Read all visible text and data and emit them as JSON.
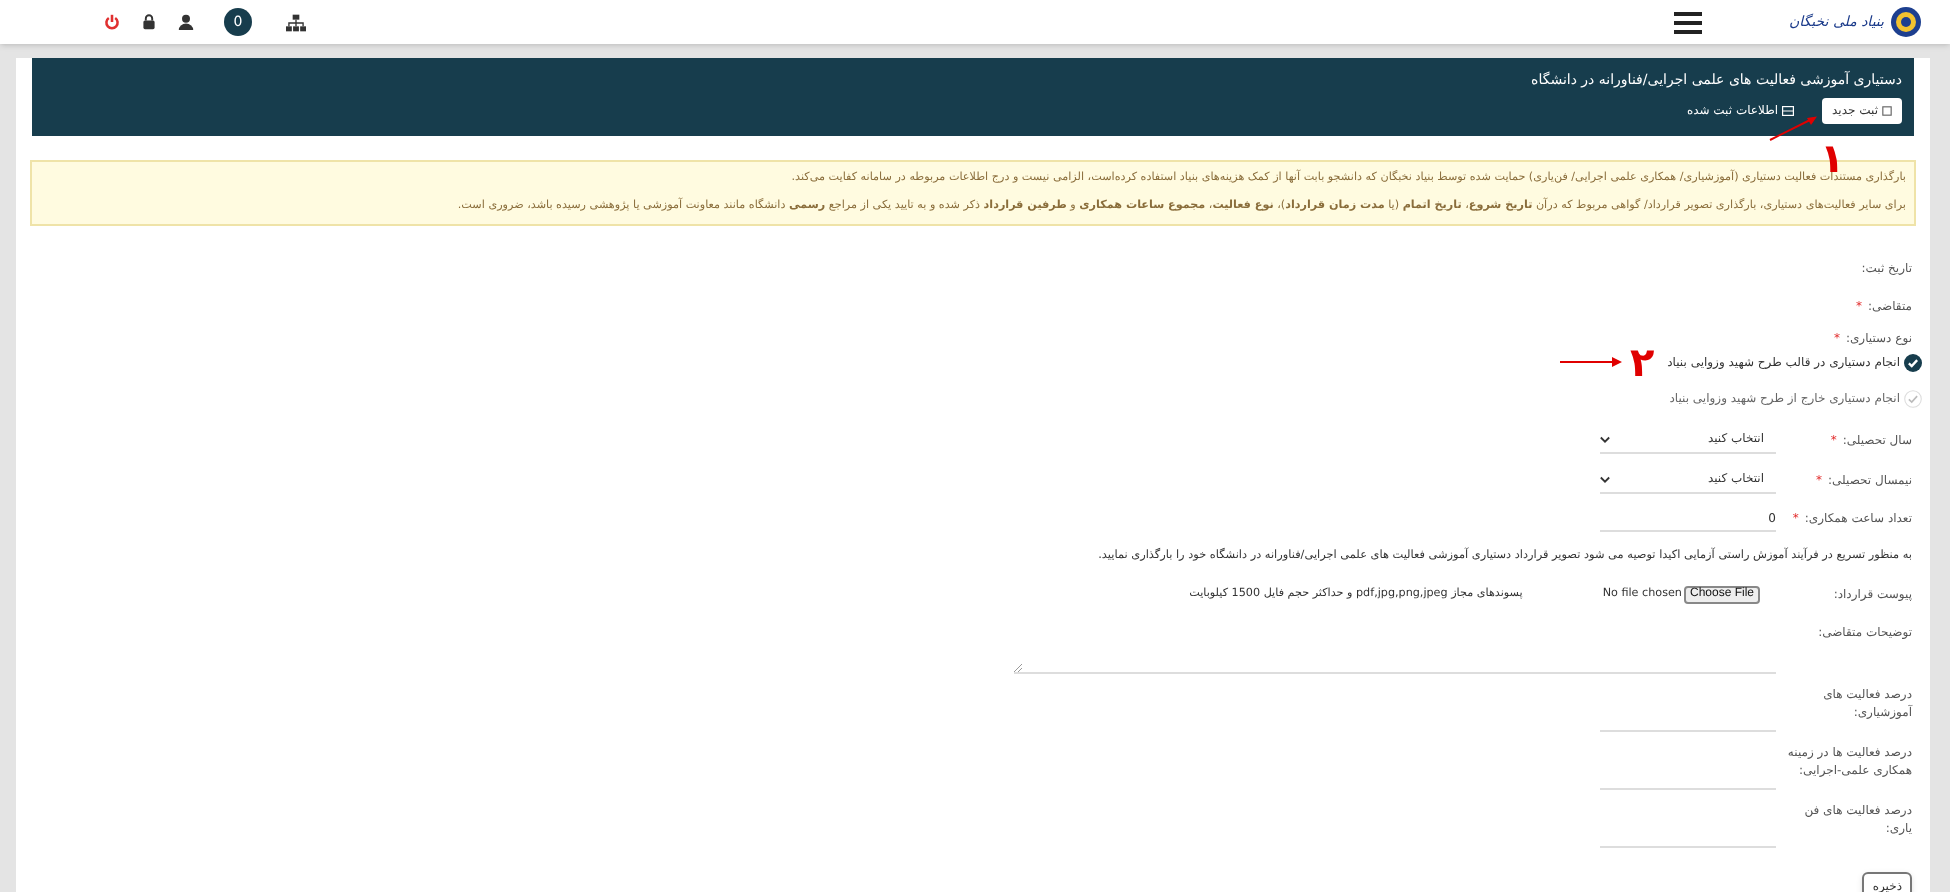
{
  "header": {
    "logo_text": "بنیاد ملی نخبگان",
    "badge": "0"
  },
  "panel": {
    "title": "دستیاری آموزشی فعالیت های علمی اجرایی/فناورانه در دانشگاه",
    "buttons": [
      {
        "label": "ثبت جدید",
        "kind": "new"
      },
      {
        "label": "اطلاعات ثبت شده",
        "kind": "list"
      }
    ]
  },
  "notice": {
    "lines": [
      "بارگذاری مستندات فعالیت دستیاری (آموزشیاری/ همکاری علمی اجرایی/ فن‌یاری) حمایت شده توسط بنیاد نخبگان که دانشجو بابت آنها از کمک هزینه‌های بنیاد استفاده کرده‌است، الزامی نیست و درج اطلاعات مربوطه در سامانه کفایت می‌کند.",
      "برای سایر فعالیت‌های دستیاری، بارگذاری تصویر قرارداد/ گواهی مربوط که درآن **تاریخ شروع**، **تاریخ اتمام** (یا **مدت زمان قرارداد**)، **نوع فعالیت**، **مجموع ساعات همکاری** و **طرفین قرارداد** ذکر شده و به تایید یکی از مراجع **رسمی** دانشگاه مانند معاونت آموزشی یا پژوهشی رسیده باشد، ضروری است."
    ]
  },
  "form": {
    "required_mark": "*",
    "fields": [
      {
        "kind": "static",
        "label": "تاریخ ثبت:",
        "required": false
      },
      {
        "kind": "static",
        "label": "متقاضی:",
        "required": true
      },
      {
        "kind": "radio",
        "label": "نوع دستیاری:",
        "required": true,
        "options": [
          {
            "label": "انجام دستیاری در قالب طرح شهید وزوایی بنیاد",
            "selected": true
          },
          {
            "label": "انجام دستیاری خارج از طرح شهید وزوایی بنیاد",
            "selected": false
          }
        ]
      },
      {
        "kind": "select",
        "label": "سال تحصیلی:",
        "required": true,
        "value": "انتخاب کنید"
      },
      {
        "kind": "select",
        "label": "نیمسال تحصیلی:",
        "required": true,
        "value": "انتخاب کنید"
      },
      {
        "kind": "text",
        "label": "تعداد ساعت همکاری:",
        "required": true,
        "value": "0"
      },
      {
        "kind": "note",
        "text": "به منظور تسریع در فرآیند آموزش راستی آزمایی اکیدا توصیه می شود تصویر قرارداد دستیاری آموزشی فعالیت های علمی اجرایی/فناورانه در دانشگاه خود را بارگذاری نمایید."
      },
      {
        "kind": "file",
        "label": "پیوست قرارداد:",
        "required": false,
        "button": "Choose File",
        "status": "No file chosen",
        "hint": "پسوندهای مجاز pdf,jpg,png,jpeg و حداکثر حجم فایل 1500 کیلوبایت"
      },
      {
        "kind": "textarea",
        "label": "توضیحات متقاضی:",
        "required": false
      },
      {
        "kind": "text",
        "label": "درصد فعالیت های آموزشیاری:",
        "required": false
      },
      {
        "kind": "text",
        "label": "درصد فعالیت ها در زمینه همکاری علمی-اجرایی:",
        "required": false
      },
      {
        "kind": "text",
        "label": "درصد فعالیت های فن یاری:",
        "required": false
      }
    ],
    "submit": "ذخیره"
  },
  "annotations": [
    {
      "text": "۱"
    },
    {
      "text": "۲"
    }
  ]
}
